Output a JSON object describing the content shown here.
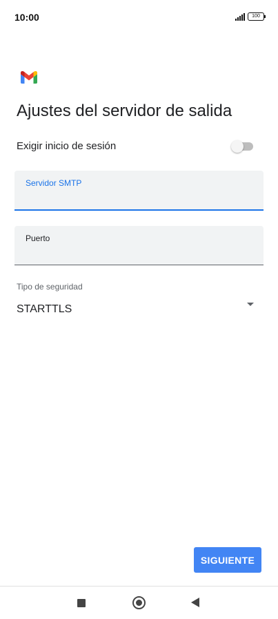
{
  "status_bar": {
    "time": "10:00",
    "battery": "100",
    "signal_icon": "signal-bars-icon",
    "battery_icon": "battery-icon"
  },
  "app": {
    "logo": "gmail-logo-icon"
  },
  "page": {
    "title": "Ajustes del servidor de salida"
  },
  "require_login": {
    "label": "Exigir inicio de sesión",
    "enabled": false
  },
  "smtp_field": {
    "label": "Servidor SMTP",
    "value": "",
    "focused": true
  },
  "port_field": {
    "label": "Puerto",
    "value": ""
  },
  "security": {
    "label": "Tipo de seguridad",
    "selected": "STARTTLS"
  },
  "actions": {
    "next_label": "SIGUIENTE"
  },
  "colors": {
    "accent": "#1a73e8",
    "button": "#4285f4",
    "field_bg": "#f1f3f4",
    "gmail_red": "#ea4335",
    "gmail_blue": "#4285f4",
    "gmail_green": "#34a853",
    "gmail_yellow": "#fbbc04"
  },
  "nav": {
    "recent_icon": "recent-apps-icon",
    "home_icon": "home-icon",
    "back_icon": "back-icon"
  }
}
